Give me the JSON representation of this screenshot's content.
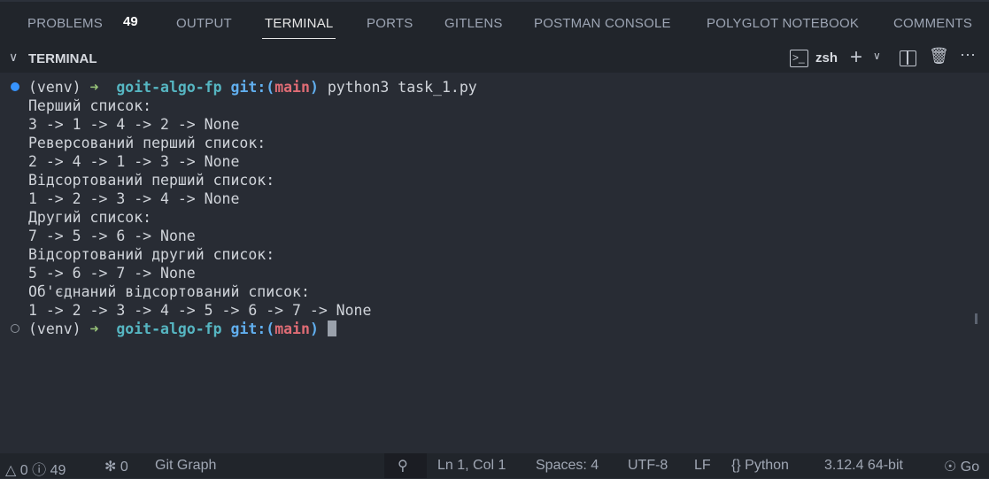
{
  "tabs": [
    {
      "label": "PROBLEMS",
      "badge": "49"
    },
    {
      "label": "OUTPUT"
    },
    {
      "label": "TERMINAL",
      "active": true
    },
    {
      "label": "PORTS"
    },
    {
      "label": "GITLENS"
    },
    {
      "label": "POSTMAN CONSOLE"
    },
    {
      "label": "POLYGLOT NOTEBOOK"
    },
    {
      "label": "COMMENTS"
    }
  ],
  "header": {
    "title": "TERMINAL",
    "shell": "zsh"
  },
  "terminal": {
    "prompt": {
      "venv": "(venv)",
      "arrow": "➜",
      "dir": "goit-algo-fp",
      "git": "git:(",
      "branch": "main",
      "git_close": ")",
      "command": "python3 task_1.py"
    },
    "output": [
      "Перший список:",
      "3 -> 1 -> 4 -> 2 -> None",
      "Реверсований перший список:",
      "2 -> 4 -> 1 -> 3 -> None",
      "Відсортований перший список:",
      "1 -> 2 -> 3 -> 4 -> None",
      "Другий список:",
      "7 -> 5 -> 6 -> None",
      "Відсортований другий список:",
      "5 -> 6 -> 7 -> None",
      "Об'єднаний відсортований список:",
      "1 -> 2 -> 3 -> 4 -> 5 -> 6 -> 7 -> None"
    ]
  },
  "status": {
    "warnings": "0",
    "infos": "49",
    "ports": "0",
    "git_graph": "Git Graph",
    "position": "Ln 1, Col 1",
    "spaces": "Spaces: 4",
    "encoding": "UTF-8",
    "eol": "LF",
    "language": "Python",
    "interpreter": "3.12.4 64-bit",
    "go_live": "Go"
  },
  "colors": {
    "accent_dot": "#3794ff"
  }
}
